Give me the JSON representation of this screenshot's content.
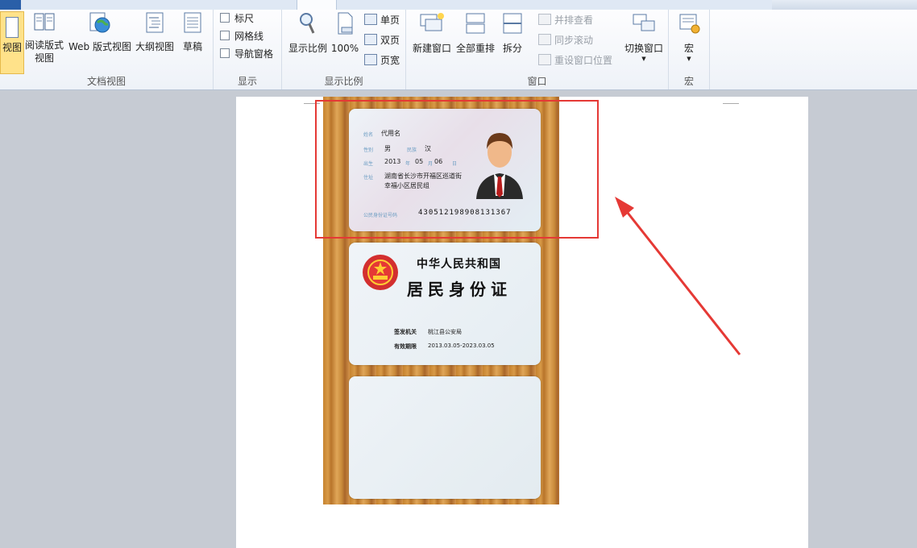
{
  "ribbon": {
    "groups": {
      "doc_views": "文档视图",
      "show": "显示",
      "zoom": "显示比例",
      "window": "窗口",
      "macro": "宏"
    },
    "doc_views": {
      "page_view": "视图",
      "reading_layout": "阅读版式\n视图",
      "web_layout": "Web 版式视图",
      "outline": "大纲视图",
      "draft": "草稿"
    },
    "show": {
      "ruler": "标尺",
      "gridlines": "网格线",
      "nav_pane": "导航窗格"
    },
    "zoom": {
      "zoom": "显示比例",
      "hundred": "100%",
      "one_page": "单页",
      "two_pages": "双页",
      "page_width": "页宽"
    },
    "window": {
      "new_window": "新建窗口",
      "arrange_all": "全部重排",
      "split": "拆分",
      "side_by_side": "并排查看",
      "sync_scroll": "同步滚动",
      "reset_position": "重设窗口位置",
      "switch_windows": "切换窗口"
    },
    "macro": {
      "macros": "宏"
    }
  },
  "id_front": {
    "name_label": "姓名",
    "name": "代用名",
    "gender_label": "性别",
    "gender": "男",
    "ethnic_label": "民族",
    "ethnic": "汉",
    "birth_label": "出生",
    "birth_year": "2013",
    "year_label": "年",
    "birth_month": "05",
    "month_label": "月",
    "birth_day": "06",
    "day_label": "日",
    "address_label": "住址",
    "address_line1": "湖南省长沙市开福区巡道街",
    "address_line2": "幸福小区居民组",
    "id_label": "公民身份证号码",
    "id_number": "430512198908131367"
  },
  "id_back": {
    "title_line1": "中华人民共和国",
    "title_line2": "居民身份证",
    "authority_label": "签发机关",
    "authority": "桃江县公安局",
    "validity_label": "有效期限",
    "validity": "2013.03.05-2023.03.05"
  },
  "colors": {
    "annotation_red": "#e53935",
    "wood": "#c6832f"
  }
}
